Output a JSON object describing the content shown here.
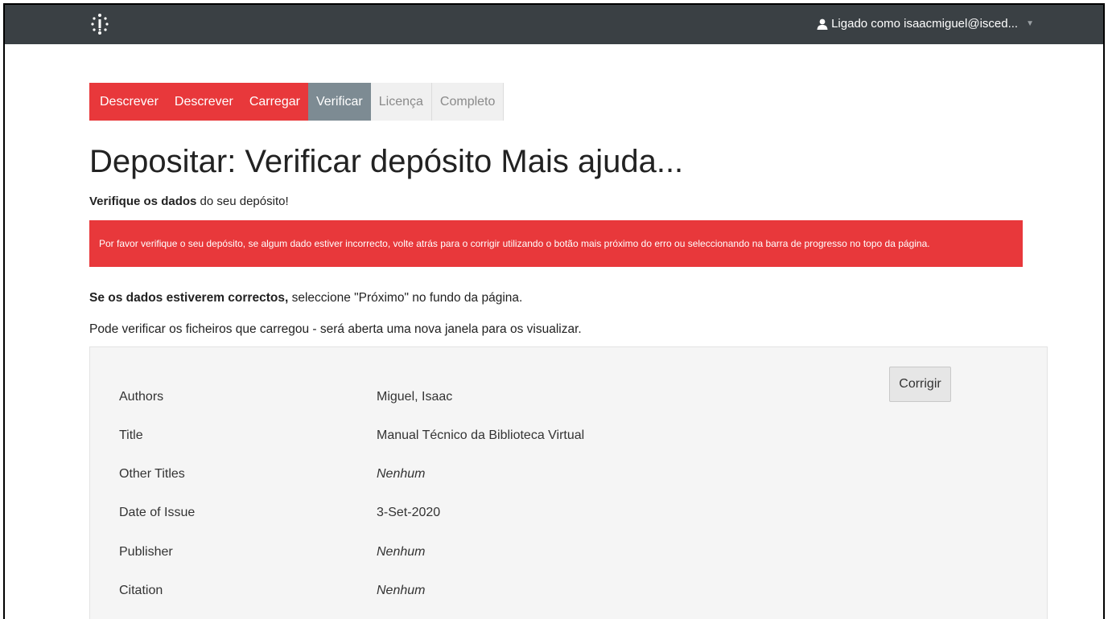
{
  "navbar": {
    "user_label": "Ligado como isaacmiguel@isced..."
  },
  "progress": {
    "steps": [
      {
        "label": "Descrever",
        "state": "done"
      },
      {
        "label": "Descrever",
        "state": "done"
      },
      {
        "label": "Carregar",
        "state": "done"
      },
      {
        "label": "Verificar",
        "state": "current"
      },
      {
        "label": "Licença",
        "state": "todo"
      },
      {
        "label": "Completo",
        "state": "todo"
      }
    ]
  },
  "page": {
    "title": "Depositar: Verificar depósito",
    "help_link": "Mais ajuda...",
    "subtitle_bold": "Verifique os dados",
    "subtitle_rest": " do seu depósito!",
    "alert": "Por favor verifique o seu depósito, se algum dado estiver incorrecto, volte atrás para o corrigir utilizando o botão mais próximo do erro ou seleccionando na barra de progresso no topo da página.",
    "line1_bold": "Se os dados estiverem correctos,",
    "line1_rest": " seleccione \"Próximo\" no fundo da página.",
    "line2": "Pode verificar os ficheiros que carregou - será aberta uma nova janela para os visualizar."
  },
  "review": {
    "fix_button": "Corrigir",
    "rows": [
      {
        "label": "Authors",
        "value": "Miguel, Isaac"
      },
      {
        "label": "Title",
        "value": "Manual Técnico da Biblioteca Virtual"
      },
      {
        "label": "Other Titles",
        "value": "Nenhum"
      },
      {
        "label": "Date of Issue",
        "value": "3-Set-2020"
      },
      {
        "label": "Publisher",
        "value": "Nenhum"
      },
      {
        "label": "Citation",
        "value": "Nenhum"
      }
    ]
  },
  "colors": {
    "navbar": "#3a4044",
    "accent_red": "#e8383b",
    "current_step": "#7d8b93"
  }
}
